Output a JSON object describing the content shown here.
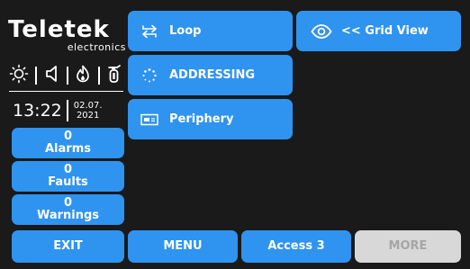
{
  "brand": {
    "logo_text": "Teletek",
    "logo_subtext": "electronics"
  },
  "status_icons": [
    "sun-icon",
    "speaker-icon",
    "fire-icon",
    "extinguisher-icon"
  ],
  "clock": {
    "time": "13:22",
    "date_line1": "02.07.",
    "date_line2": "2021"
  },
  "counters": [
    {
      "count": "0",
      "label": "Alarms"
    },
    {
      "count": "0",
      "label": "Faults"
    },
    {
      "count": "0",
      "label": "Warnings"
    }
  ],
  "menu": {
    "loop": "Loop",
    "addressing": "ADDRESSING",
    "periphery": "Periphery",
    "grid_view": "<< Grid View"
  },
  "bottom_bar": {
    "exit": "EXIT",
    "menu": "MENU",
    "access": "Access 3",
    "more": "MORE"
  },
  "colors": {
    "accent": "#2f93f0",
    "background": "#1a1a1a",
    "disabled": "#d8d8d8",
    "disabled_text": "#a6a6a6"
  }
}
